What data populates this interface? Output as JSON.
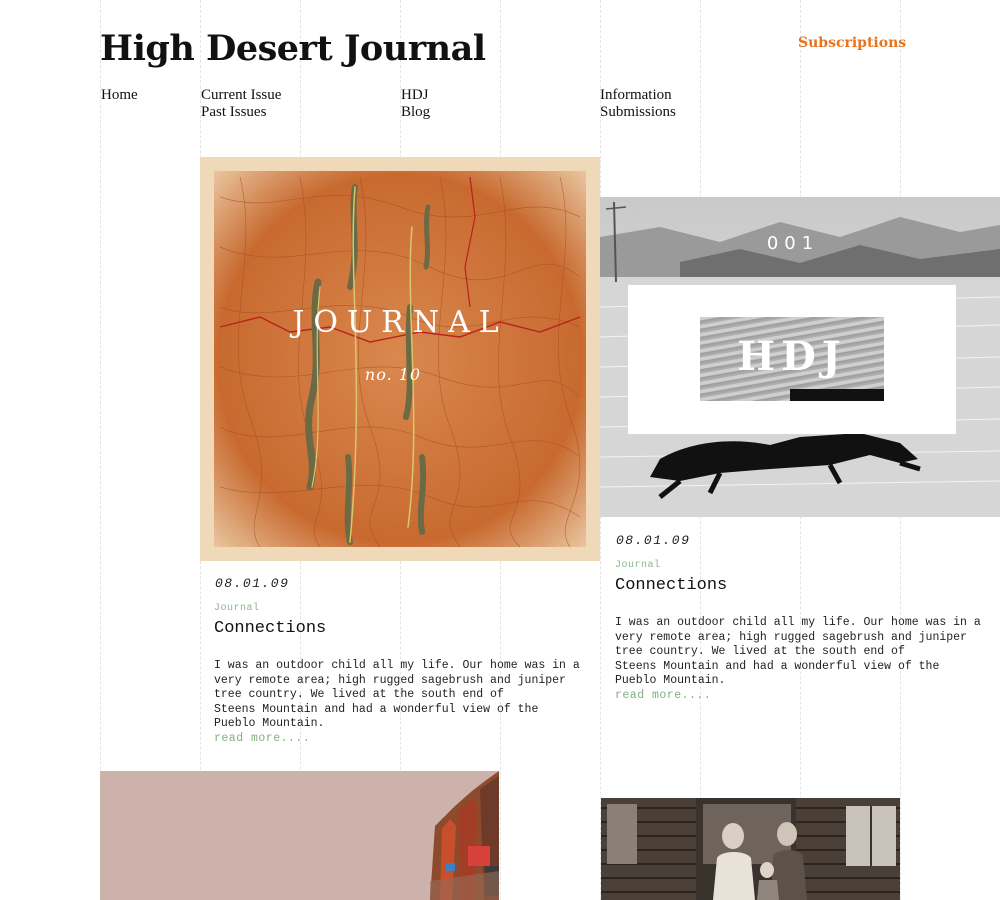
{
  "site": {
    "title": "High Desert Journal",
    "subscriptions_label": "Subscriptions"
  },
  "nav": {
    "home": "Home",
    "current_issue": "Current Issue",
    "past_issues": "Past Issues",
    "hdj": "HDJ",
    "blog": "Blog",
    "information": "Information",
    "submissions": "Submissions"
  },
  "posts": [
    {
      "cover_title": "Journal",
      "cover_issue": "no. 10",
      "date": "08.01.09",
      "category": "Journal",
      "title": "Connections",
      "excerpt_lines": [
        "I was an outdoor child all my life. Our home was in a",
        "very remote area; high rugged sagebrush and juniper",
        "tree country. We lived at the south end of",
        "Steens Mountain and had a wonderful view of the",
        "Pueblo Mountain."
      ],
      "read_more": "read more...."
    },
    {
      "cover_number": "001",
      "cover_logo": "HDJ",
      "date": "08.01.09",
      "category": "Journal",
      "title": "Connections",
      "excerpt_lines": [
        "I was an outdoor child all my life. Our home was in a",
        "very remote area; high rugged sagebrush and juniper",
        "tree country. We lived at the south end of",
        "Steens Mountain and had a wonderful view of the",
        "Pueblo Mountain."
      ],
      "read_more": "read more...."
    }
  ],
  "colors": {
    "accent": "#e8731c",
    "category": "#8ab88a",
    "link": "#7fb07f"
  }
}
